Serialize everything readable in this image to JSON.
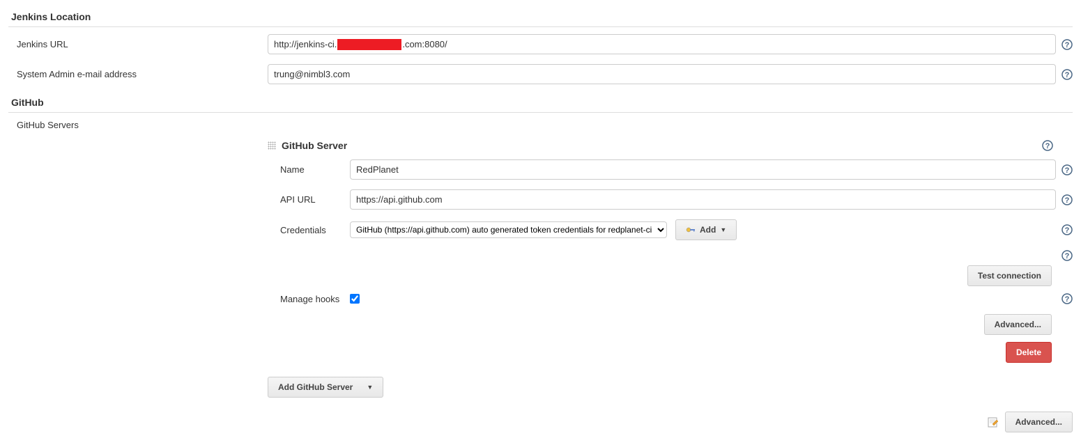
{
  "jenkins_location": {
    "section_title": "Jenkins Location",
    "url_label": "Jenkins URL",
    "url_prefix": "http://jenkins-ci.",
    "url_suffix": ".com:8080/",
    "email_label": "System Admin e-mail address",
    "email_value": "trung@nimbl3.com"
  },
  "github": {
    "section_title": "GitHub",
    "servers_label": "GitHub Servers",
    "server": {
      "title": "GitHub Server",
      "name_label": "Name",
      "name_value": "RedPlanet",
      "api_url_label": "API URL",
      "api_url_value": "https://api.github.com",
      "credentials_label": "Credentials",
      "credentials_value": "GitHub (https://api.github.com) auto generated token credentials for redplanet-ci",
      "add_cred_label": "Add",
      "test_connection_label": "Test connection",
      "manage_hooks_label": "Manage hooks",
      "manage_hooks_checked": true,
      "advanced_label": "Advanced...",
      "delete_label": "Delete"
    },
    "add_server_label": "Add GitHub Server",
    "outer_advanced_label": "Advanced..."
  }
}
